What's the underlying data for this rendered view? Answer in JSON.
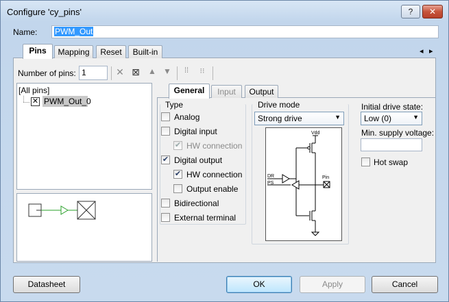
{
  "window": {
    "title": "Configure 'cy_pins'",
    "help_label": "?",
    "minimize_label": "–",
    "close_label": "✕"
  },
  "name_field": {
    "label": "Name:",
    "value": "PWM_Out"
  },
  "main_tabs": [
    {
      "label": "Pins",
      "active": true
    },
    {
      "label": "Mapping",
      "active": false
    },
    {
      "label": "Reset",
      "active": false
    },
    {
      "label": "Built-in",
      "active": false
    }
  ],
  "tab_nav": {
    "prev": "◂",
    "next": "▸"
  },
  "toolbar": {
    "num_pins_label": "Number of pins:",
    "num_pins_value": "1"
  },
  "pin_tree": {
    "root": "[All pins]",
    "item": "PWM_Out_0"
  },
  "sub_tabs": [
    {
      "label": "General",
      "active": true
    },
    {
      "label": "Input",
      "active": false
    },
    {
      "label": "Output",
      "active": false
    }
  ],
  "type_group": {
    "title": "Type",
    "analog": {
      "label": "Analog",
      "checked": false
    },
    "digital_input": {
      "label": "Digital input",
      "checked": false
    },
    "digital_input_hw": {
      "label": "HW connection",
      "checked": true,
      "disabled": true
    },
    "digital_output": {
      "label": "Digital output",
      "checked": true
    },
    "digital_output_hw": {
      "label": "HW connection",
      "checked": true
    },
    "output_enable": {
      "label": "Output enable",
      "checked": false
    },
    "bidirectional": {
      "label": "Bidirectional",
      "checked": false
    },
    "external_terminal": {
      "label": "External terminal",
      "checked": false
    }
  },
  "drive_mode": {
    "label": "Drive mode",
    "value": "Strong drive"
  },
  "drive_diagram": {
    "vdd": "Vdd",
    "dr": "DR",
    "ps": "PS",
    "pin": "Pin"
  },
  "right_panel": {
    "initial_drive_label": "Initial drive state:",
    "initial_drive_value": "Low (0)",
    "min_supply_label": "Min. supply voltage:",
    "min_supply_value": "",
    "hot_swap": {
      "label": "Hot swap",
      "checked": false
    }
  },
  "buttons": {
    "datasheet": "Datasheet",
    "ok": "OK",
    "apply": "Apply",
    "cancel": "Cancel"
  },
  "check_mark": "✔"
}
